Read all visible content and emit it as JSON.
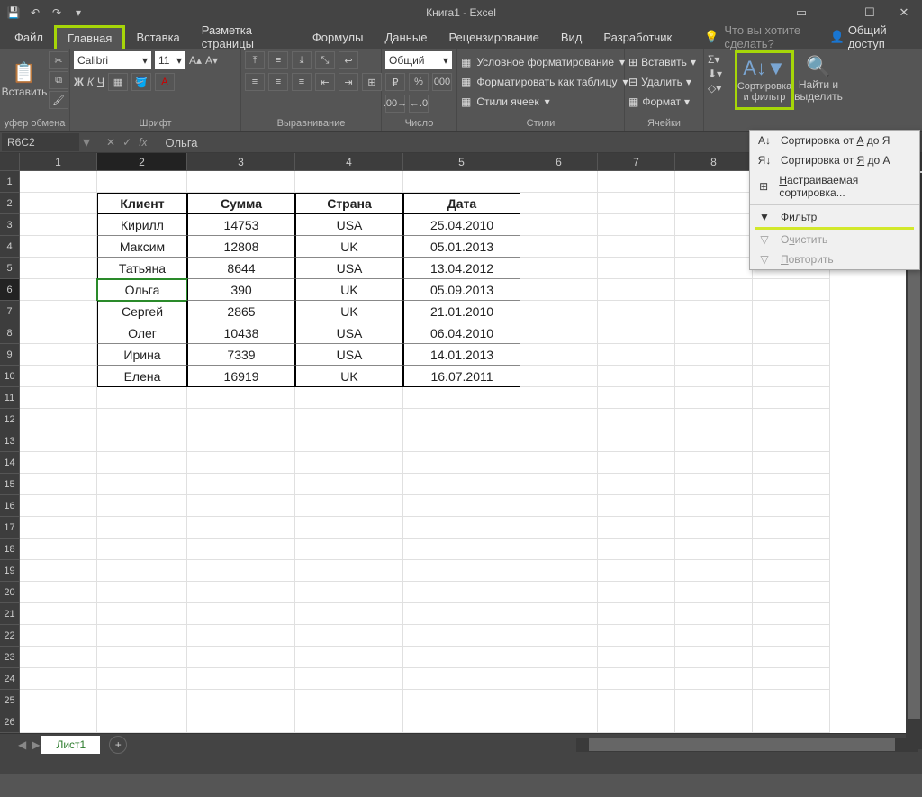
{
  "title": "Книга1 - Excel",
  "qat": {
    "save": "💾",
    "undo": "↶",
    "redo": "↷"
  },
  "window": {
    "ribbonOpts": "▭",
    "min": "—",
    "max": "☐",
    "close": "✕"
  },
  "tabs": {
    "file": "Файл",
    "home": "Главная",
    "insert": "Вставка",
    "layout": "Разметка страницы",
    "formulas": "Формулы",
    "data": "Данные",
    "review": "Рецензирование",
    "view": "Вид",
    "developer": "Разработчик",
    "tellme": "Что вы хотите сделать?",
    "share": "Общий доступ"
  },
  "ribbon": {
    "clipboard": {
      "paste": "Вставить",
      "label": "уфер обмена"
    },
    "font": {
      "name": "Calibri",
      "size": "11",
      "label": "Шрифт"
    },
    "align": {
      "label": "Выравнивание"
    },
    "number": {
      "format": "Общий",
      "label": "Число"
    },
    "styles": {
      "cond": "Условное форматирование",
      "table": "Форматировать как таблицу",
      "cell": "Стили ячеек",
      "label": "Стили"
    },
    "cells": {
      "insert": "Вставить",
      "delete": "Удалить",
      "format": "Формат",
      "label": "Ячейки"
    },
    "editing": {
      "sort": "Сортировка и фильтр",
      "find": "Найти и выделить"
    }
  },
  "dropdown": {
    "sortAZ": "Сортировка от А до Я",
    "sortZA": "Сортировка от Я до А",
    "custom": "Настраиваемая сортировка...",
    "filter": "Фильтр",
    "clear": "Очистить",
    "reapply": "Повторить"
  },
  "namebox": "R6C2",
  "formula": "Ольга",
  "columns": [
    "1",
    "2",
    "3",
    "4",
    "5",
    "6",
    "7",
    "8"
  ],
  "table": {
    "headers": [
      "Клиент",
      "Сумма",
      "Страна",
      "Дата"
    ],
    "rows": [
      [
        "Кирилл",
        "14753",
        "USA",
        "25.04.2010"
      ],
      [
        "Максим",
        "12808",
        "UK",
        "05.01.2013"
      ],
      [
        "Татьяна",
        "8644",
        "USA",
        "13.04.2012"
      ],
      [
        "Ольга",
        "390",
        "UK",
        "05.09.2013"
      ],
      [
        "Сергей",
        "2865",
        "UK",
        "21.01.2010"
      ],
      [
        "Олег",
        "10438",
        "USA",
        "06.04.2010"
      ],
      [
        "Ирина",
        "7339",
        "USA",
        "14.01.2013"
      ],
      [
        "Елена",
        "16919",
        "UK",
        "16.07.2011"
      ]
    ]
  },
  "sheet": "Лист1",
  "activeCell": {
    "row": 6,
    "col": 2
  }
}
